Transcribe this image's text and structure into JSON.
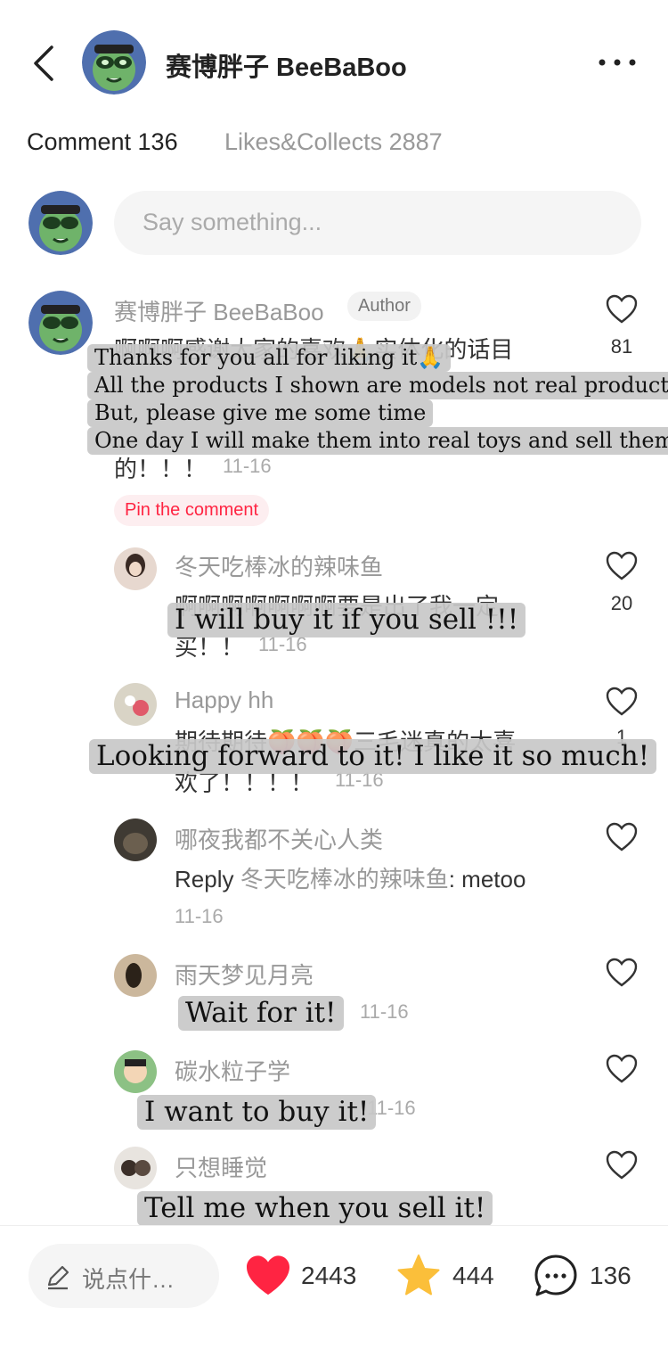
{
  "header": {
    "back_icon": "chevron-left-icon",
    "username": "赛博胖子 BeeBaBoo",
    "more_icon": "more-dots-icon"
  },
  "tabs": [
    {
      "label": "Comment 136",
      "active": true
    },
    {
      "label": "Likes&Collects 2887",
      "active": false
    }
  ],
  "composer": {
    "placeholder": "Say something..."
  },
  "author_comment": {
    "username": "赛博胖子 BeeBaBoo",
    "badge": "Author",
    "text_line1": "啊啊啊感谢大家的喜欢🙏实体化的话目",
    "text_line4": "的！！！",
    "date": "11-16",
    "likes": "81",
    "pin_label": "Pin the comment",
    "translation": [
      "Thanks for you all for liking it🙏",
      "All the products I shown are models not real products",
      "But, please give me some time",
      "One day I will make them into real toys and sell them"
    ]
  },
  "replies": [
    {
      "username": "冬天吃棒冰的辣味鱼",
      "text_line1": "啊啊啊啊啊啊啊要是出了我一定",
      "text_line2": "买！！",
      "date": "11-16",
      "likes": "20",
      "translation": "I will buy it if you sell !!!"
    },
    {
      "username": "Happy hh",
      "text_line1": "期待期待🍑🍑🍑三毛迷真的太喜",
      "text_line2": "欢了！！！！",
      "date": "11-16",
      "likes": "1",
      "translation": "Looking forward to it! I like it so much!"
    },
    {
      "username": "哪夜我都不关心人类",
      "reply_prefix": "Reply",
      "reply_target": "冬天吃棒冰的辣味鱼",
      "reply_text": ": metoo",
      "date": "11-16",
      "likes": ""
    },
    {
      "username": "雨天梦见月亮",
      "date": "11-16",
      "likes": "",
      "translation": "Wait for it!"
    },
    {
      "username": "碳水粒子学",
      "date": "11-16",
      "likes": "",
      "translation": "I want to buy it!"
    },
    {
      "username": "只想睡觉",
      "likes": "",
      "translation": "Tell me when you sell it!"
    }
  ],
  "bottom_bar": {
    "input_placeholder": "说点什…",
    "likes": "2443",
    "collects": "444",
    "comments": "136"
  },
  "colors": {
    "heart_red": "#ff2442",
    "star_yellow": "#fbbf3a",
    "pin_text": "#ff2442",
    "pin_bg": "#fdeef0"
  }
}
